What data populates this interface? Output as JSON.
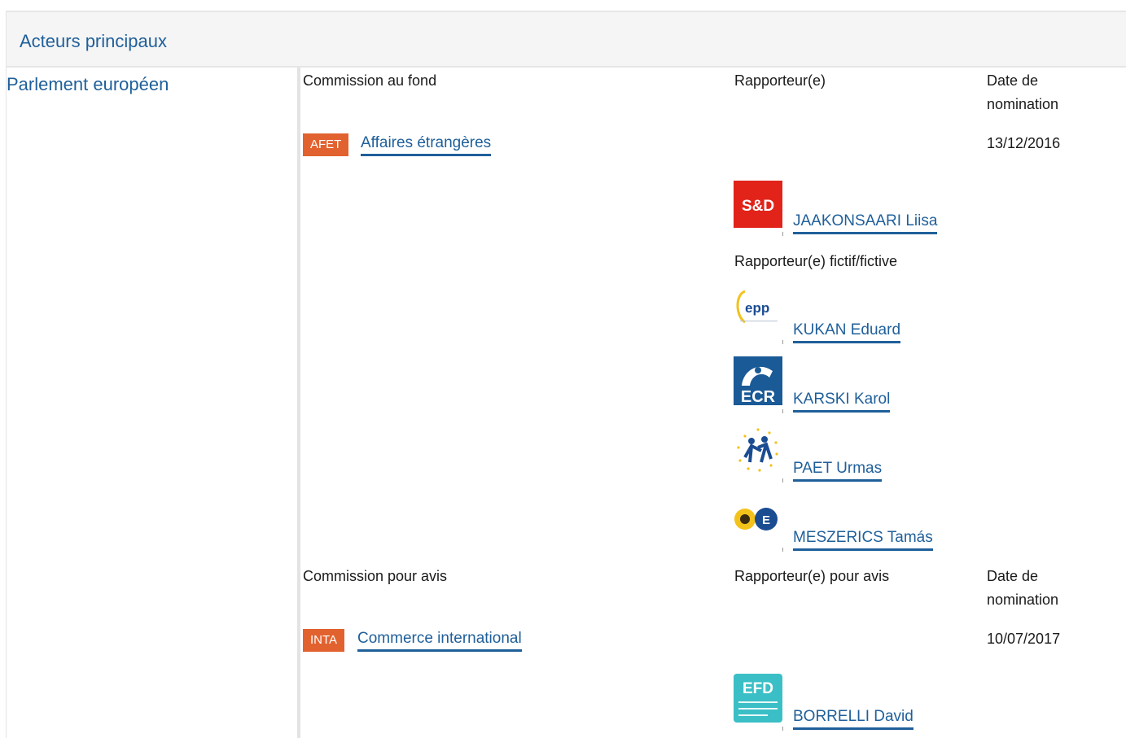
{
  "header": {
    "title": "Acteurs principaux"
  },
  "left": {
    "title": "Parlement européen"
  },
  "fond": {
    "col_commission": "Commission au fond",
    "col_rapporteur": "Rapporteur(e)",
    "col_date": "Date de nomination",
    "committee_code": "AFET",
    "committee_name": "Affaires étrangères",
    "date": "13/12/2016",
    "rapporteur": {
      "name": "JAAKONSAARI Liisa",
      "group_logo": "S&D"
    },
    "shadow_label": "Rapporteur(e) fictif/fictive",
    "shadows": [
      {
        "name": "KUKAN Eduard",
        "group_logo": "epp"
      },
      {
        "name": "KARSKI Karol",
        "group_logo": "ECR"
      },
      {
        "name": "PAET Urmas",
        "group_logo": "alde-icon"
      },
      {
        "name": "MESZERICS Tamás",
        "group_logo": "greens-efa-icon"
      }
    ]
  },
  "avis": {
    "col_commission": "Commission pour avis",
    "col_rapporteur": "Rapporteur(e) pour avis",
    "col_date": "Date de nomination",
    "committee_code": "INTA",
    "committee_name": "Commerce international",
    "date": "10/07/2017",
    "rapporteur": {
      "name": "BORRELLI David",
      "group_logo": "EFD"
    }
  },
  "colors": {
    "link": "#1f5f9a",
    "badge": "#e2622f",
    "sd_red": "#e2231a",
    "ecr_blue": "#1a5a96",
    "efd_teal": "#3bbfc6"
  }
}
